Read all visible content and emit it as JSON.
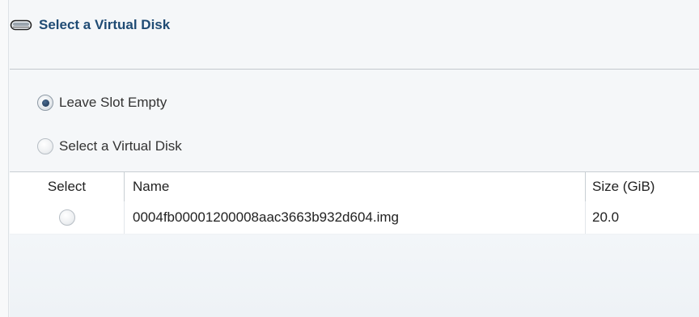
{
  "header": {
    "title": "Select a Virtual Disk",
    "icon": "disk-drive-icon"
  },
  "options": {
    "leave_empty": {
      "label": "Leave Slot Empty",
      "selected": true
    },
    "select_disk": {
      "label": "Select a Virtual Disk",
      "selected": false
    }
  },
  "table": {
    "columns": [
      "Select",
      "Name",
      "Size (GiB)"
    ],
    "rows": [
      {
        "selected": false,
        "name": "0004fb00001200008aac3663b932d604.img",
        "size": "20.0"
      }
    ]
  },
  "colors": {
    "header_text": "#1f4b74",
    "body_text": "#333333"
  }
}
